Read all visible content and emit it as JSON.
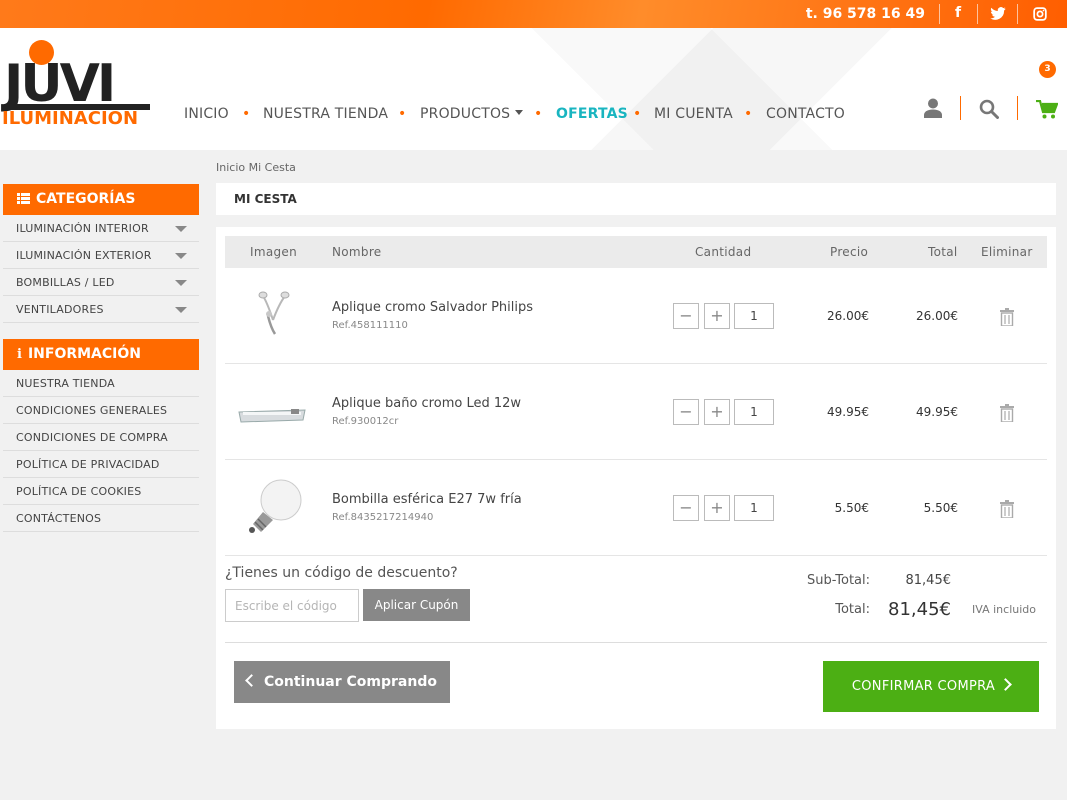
{
  "topbar": {
    "phone": "t. 96 578 16 49",
    "social": {
      "facebook": "f",
      "twitter": "twitter-icon",
      "instagram": "instagram-icon"
    }
  },
  "brand": {
    "logo_main": "JUVI",
    "logo_sub": "ILUMINACION"
  },
  "nav": {
    "items": [
      {
        "label": "INICIO"
      },
      {
        "label": "NUESTRA TIENDA"
      },
      {
        "label": "PRODUCTOS"
      },
      {
        "label": "OFERTAS"
      },
      {
        "label": "MI CUENTA"
      },
      {
        "label": "CONTACTO"
      }
    ],
    "cart_count": "3"
  },
  "breadcrumb": "Inicio Mi Cesta",
  "sidebar": {
    "categories_title": "CATEGORÍAS",
    "categories": [
      {
        "label": "ILUMINACIÓN INTERIOR"
      },
      {
        "label": "ILUMINACIÓN EXTERIOR"
      },
      {
        "label": "BOMBILLAS / LED"
      },
      {
        "label": "VENTILADORES"
      }
    ],
    "info_title": "INFORMACIÓN",
    "info": [
      {
        "label": "NUESTRA TIENDA"
      },
      {
        "label": "CONDICIONES GENERALES"
      },
      {
        "label": "CONDICIONES DE COMPRA"
      },
      {
        "label": "POLÍTICA DE PRIVACIDAD"
      },
      {
        "label": "POLÍTICA DE COOKIES"
      },
      {
        "label": "CONTÁCTENOS"
      }
    ]
  },
  "cart": {
    "title": "MI CESTA",
    "columns": [
      "Imagen",
      "Nombre",
      "Cantidad",
      "Precio",
      "Total",
      "Eliminar"
    ],
    "items": [
      {
        "name": "Aplique cromo Salvador Philips",
        "ref": "Ref.458111110",
        "qty": "1",
        "price": "26.00€",
        "total": "26.00€"
      },
      {
        "name": "Aplique baño cromo Led 12w",
        "ref": "Ref.930012cr",
        "qty": "1",
        "price": "49.95€",
        "total": "49.95€"
      },
      {
        "name": "Bombilla esférica E27 7w fría",
        "ref": "Ref.8435217214940",
        "qty": "1",
        "price": "5.50€",
        "total": "5.50€"
      }
    ],
    "coupon_question": "¿Tienes un código de descuento?",
    "coupon_placeholder": "Escribe el código",
    "coupon_button": "Aplicar Cupón",
    "subtotal_label": "Sub-Total:",
    "subtotal_value": "81,45€",
    "total_label": "Total:",
    "total_value": "81,45€",
    "tax_note": "IVA incluido",
    "continue_label": "Continuar Comprando",
    "confirm_label": "CONFIRMAR COMPRA"
  }
}
